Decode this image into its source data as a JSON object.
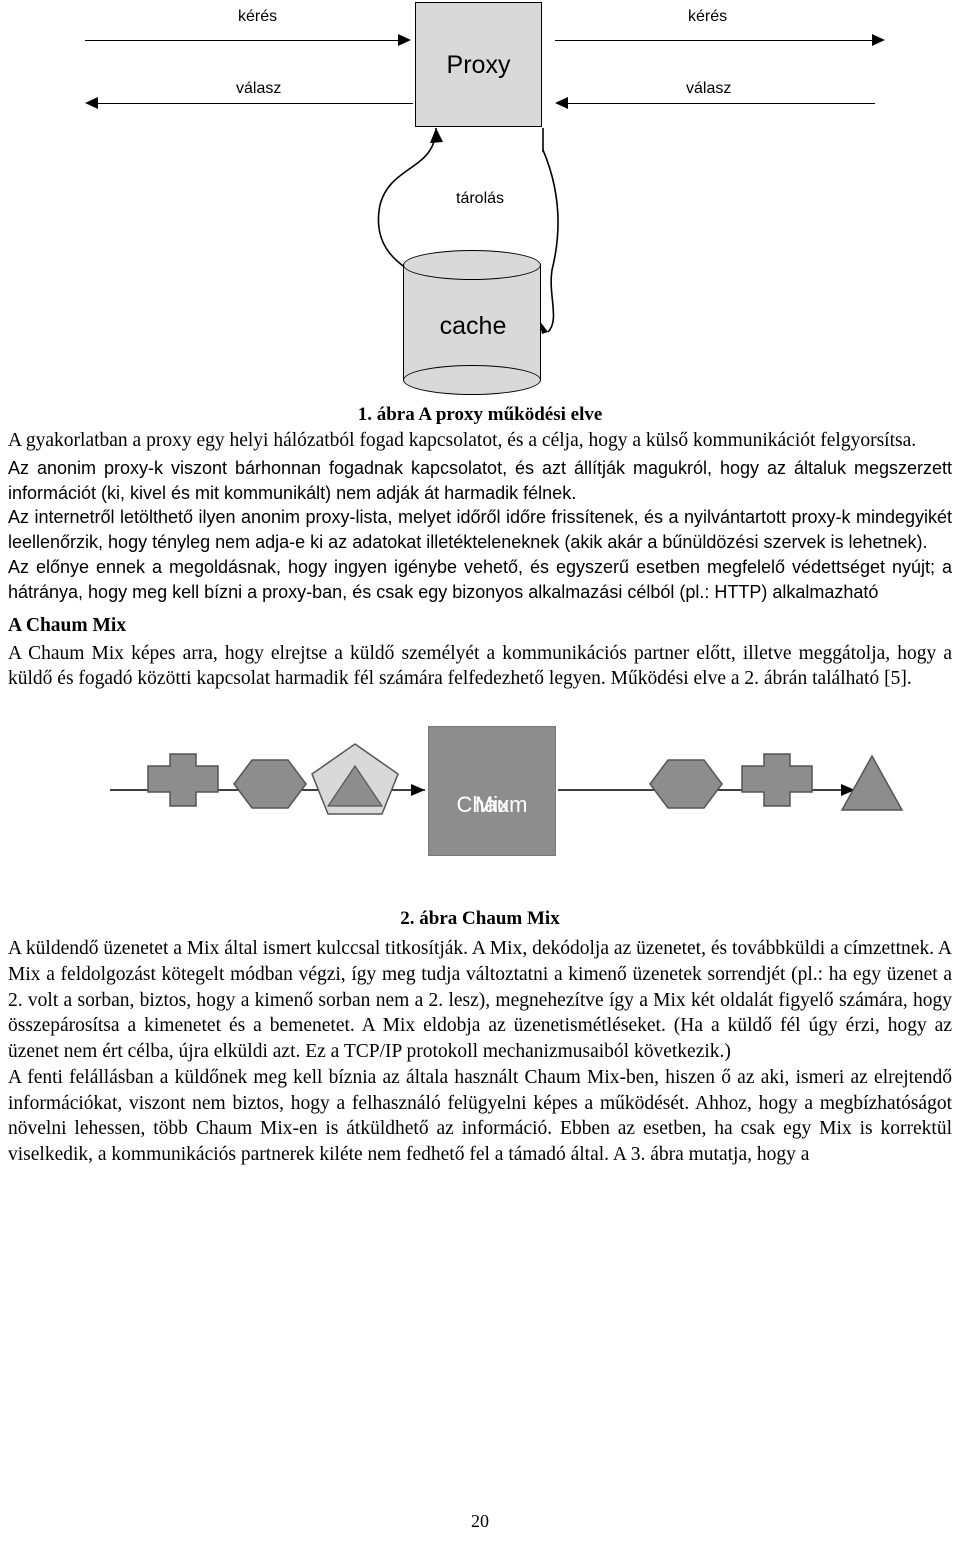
{
  "figure1": {
    "labels": {
      "request_left": "kérés",
      "response_left": "válasz",
      "request_right": "kérés",
      "response_right": "válasz",
      "storage": "tárolás"
    },
    "proxy_box": "Proxy",
    "cache_box": "cache",
    "caption": "1. ábra A proxy működési elve"
  },
  "paragraphs": {
    "p1": "A gyakorlatban a proxy egy helyi hálózatból fogad kapcsolatot, és a célja, hogy a külső kommunikációt felgyorsítsa.",
    "p2": "Az anonim proxy-k viszont bárhonnan fogadnak kapcsolatot, és azt állítják magukról, hogy az általuk megszerzett információt (ki, kivel és mit kommunikált) nem adják át harmadik félnek.",
    "p3": "Az internetről letölthető ilyen anonim proxy-lista, melyet időről időre frissítenek, és a nyilvántartott proxy-k mindegyikét leellenőrzik, hogy tényleg nem adja-e ki az adatokat illetékteleneknek (akik akár a bűnüldözési szervek is lehetnek).",
    "p4": "Az előnye ennek a megoldásnak, hogy ingyen igénybe vehető, és egyszerű esetben megfelelő védettséget nyújt; a hátránya, hogy meg kell bízni a proxy-ban, és csak egy bizonyos alkalmazási célból (pl.: HTTP) alkalmazható",
    "subhead": "A Chaum Mix",
    "p5": "A Chaum Mix képes arra, hogy elrejtse a küldő személyét a kommunikációs partner előtt, illetve meggátolja, hogy a küldő és fogadó közötti kapcsolat harmadik fél számára felfedezhető legyen. Működési elve a 2. ábrán található [5].",
    "p6": "A küldendő üzenetet a Mix által ismert kulccsal titkosítják. A Mix, dekódolja az üzenetet, és továbbküldi a címzettnek. A Mix a feldolgozást kötegelt módban végzi, így meg tudja változtatni a kimenő üzenetek sorrendjét (pl.: ha egy üzenet a 2. volt a sorban, biztos, hogy a kimenő sorban nem a 2. lesz), megnehezítve így a Mix két oldalát figyelő számára, hogy összepárosítsa a kimenetet és a bemenetet. A Mix eldobja az üzenetismétléseket. (Ha a küldő fél úgy érzi, hogy az üzenet nem ért célba, újra elküldi azt. Ez a TCP/IP protokoll mechanizmusaiból következik.)",
    "p7": "A fenti felállásban a küldőnek meg kell bíznia az általa használt Chaum Mix-ben, hiszen ő az aki, ismeri az elrejtendő információkat, viszont nem biztos, hogy a felhasználó felügyelni képes a működését. Ahhoz, hogy a megbízhatóságot növelni lehessen, több Chaum Mix-en is átküldhető az információ. Ebben az esetben, ha csak egy Mix is korrektül viselkedik, a kommunikációs partnerek kiléte nem fedhető fel a támadó által. A 3. ábra mutatja, hogy a"
  },
  "figure2": {
    "box_line1": "Chaum",
    "box_line2": "Mix",
    "caption": "2. ábra Chaum Mix",
    "shapes_left": [
      "cross-shape",
      "hexagon-shape",
      "pentagon-with-triangle-shape"
    ],
    "shapes_right": [
      "hexagon-shape",
      "cross-shape",
      "triangle-shape"
    ]
  },
  "footer": {
    "page_number": "20"
  },
  "colors": {
    "proxy_fill": "#d9d9d9",
    "mix_fill": "#8d8d8d",
    "shape_fill": "#8d8d8d",
    "shape_light_fill": "#d9d9d9",
    "text": "#000000"
  }
}
